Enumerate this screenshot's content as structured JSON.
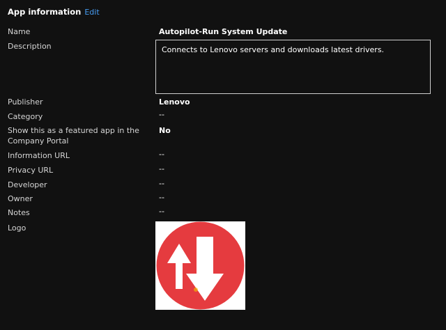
{
  "header": {
    "title": "App information",
    "edit_label": "Edit"
  },
  "fields": {
    "name": {
      "label": "Name",
      "value": "Autopilot-Run System Update"
    },
    "description": {
      "label": "Description",
      "value": "Connects to Lenovo servers and downloads latest drivers."
    },
    "publisher": {
      "label": "Publisher",
      "value": "Lenovo"
    },
    "category": {
      "label": "Category",
      "value": "--"
    },
    "featured": {
      "label_line1": "Show this as a featured app in the",
      "label_line2": "Company Portal",
      "value": "No"
    },
    "information_url": {
      "label": "Information URL",
      "value": "--"
    },
    "privacy_url": {
      "label": "Privacy URL",
      "value": "--"
    },
    "developer": {
      "label": "Developer",
      "value": "--"
    },
    "owner": {
      "label": "Owner",
      "value": "--"
    },
    "notes": {
      "label": "Notes",
      "value": "--"
    },
    "logo": {
      "label": "Logo",
      "icon": "up-down-arrows-icon"
    }
  },
  "colors": {
    "background": "#111111",
    "link": "#479ef5",
    "logo_red": "#e53b3f",
    "logo_bg": "#ffffff"
  }
}
